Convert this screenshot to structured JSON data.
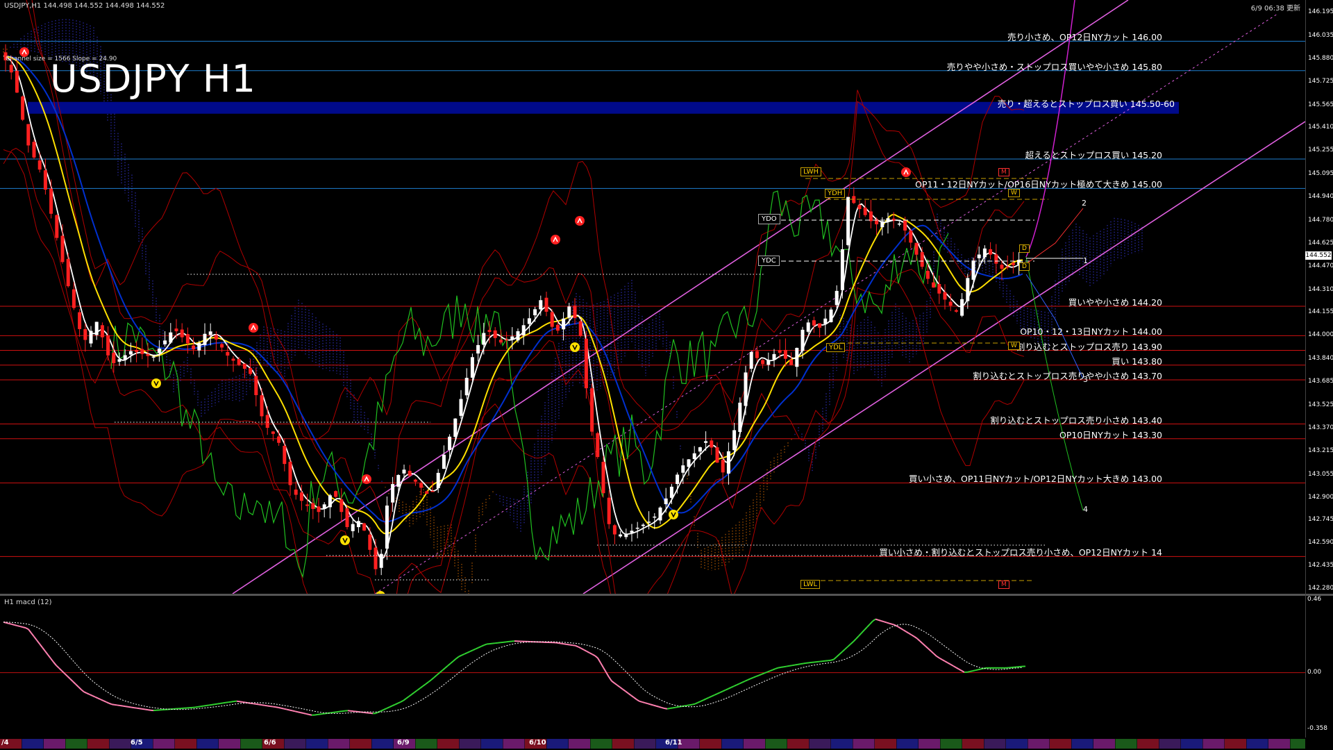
{
  "header": {
    "symbol_info": "USDJPY,H1  144.498 144.552 144.498 144.552",
    "title": "USDJPY H1",
    "channel_info": "Channel size = 1566 Slope = 24.90",
    "timestamp": "6/9 06:38 更新",
    "macd_label": "H1  macd (12)"
  },
  "chart_data": {
    "type": "line",
    "symbol": "USDJPY",
    "timeframe": "H1",
    "current_price": "144.552",
    "price_axis_ticks": [
      "146.195",
      "146.035",
      "145.880",
      "145.725",
      "145.565",
      "145.410",
      "145.255",
      "145.095",
      "144.940",
      "144.780",
      "144.625",
      "144.470",
      "144.310",
      "144.155",
      "144.000",
      "143.840",
      "143.685",
      "143.525",
      "143.370",
      "143.215",
      "143.055",
      "142.900",
      "142.745",
      "142.590",
      "142.435",
      "142.280"
    ],
    "ylim": [
      142.25,
      146.25
    ],
    "time_labels": [
      "/4",
      "6/5",
      "6/6",
      "6/9",
      "6/10",
      "6/11"
    ],
    "levels": [
      {
        "price": 146.0,
        "label": "売り小さめ、OP12日NYカット 146.00",
        "color": "#1e7fd0"
      },
      {
        "price": 145.8,
        "label": "売りやや小さめ・ストップロス買いやや小さめ 145.80",
        "color": "#1e7fd0"
      },
      {
        "price": 145.55,
        "label": "売り・超えるとストップロス買い 145.50-60",
        "color": "#1e7fd0",
        "highlight": true
      },
      {
        "price": 145.2,
        "label": "超えるとストップロス買い 145.20",
        "color": "#1e7fd0"
      },
      {
        "price": 145.0,
        "label": "OP11・12日NYカット/OP16日NYカット極めて大きめ 145.00",
        "color": "#1e7fd0"
      },
      {
        "price": 144.2,
        "label": "買いやや小さめ 144.20",
        "color": "#d01010"
      },
      {
        "price": 144.0,
        "label": "OP10・12・13日NYカット 144.00",
        "color": "#d01010"
      },
      {
        "price": 143.9,
        "label": "割り込むとストップロス売り 143.90",
        "color": "#d01010"
      },
      {
        "price": 143.8,
        "label": "買い 143.80",
        "color": "#d01010"
      },
      {
        "price": 143.7,
        "label": "割り込むとストップロス売りやや小さめ 143.70",
        "color": "#d01010"
      },
      {
        "price": 143.4,
        "label": "割り込むとストップロス売り小さめ 143.40",
        "color": "#d01010"
      },
      {
        "price": 143.3,
        "label": "OP10日NYカット 143.30",
        "color": "#d01010"
      },
      {
        "price": 143.0,
        "label": "買い小さめ、OP11日NYカット/OP12日NYカット大きめ 143.00",
        "color": "#d01010"
      },
      {
        "price": 142.5,
        "label": "買い小さめ・割り込むとストップロス売り小さめ、OP12日NYカット 14",
        "color": "#d01010"
      }
    ],
    "tags": [
      "LWH",
      "YDH",
      "YDO",
      "YDC",
      "YDL",
      "LWL",
      "W",
      "M",
      "D"
    ],
    "wave_labels": [
      "1",
      "2",
      "3",
      "4"
    ],
    "macd": {
      "ticks": [
        "0.46",
        "0.00",
        "-0.358"
      ],
      "ylim": [
        -0.36,
        0.46
      ]
    }
  },
  "colors": {
    "support_lines": "#d01010",
    "resistance_lines": "#1e7fd0",
    "channel": "#e060e0",
    "ma_fast": "#ffffff",
    "ma_mid": "#ffe000",
    "ma_slow": "#0030d0",
    "cloud_up": "#3030c0",
    "cloud_down": "#c06000",
    "chikou": "#20c020",
    "bull_candle": "#ffffff",
    "bear_candle": "#ff2020",
    "macd_line": "#30d030",
    "macd_line_down": "#ff80b0",
    "macd_signal": "#ffffff"
  }
}
